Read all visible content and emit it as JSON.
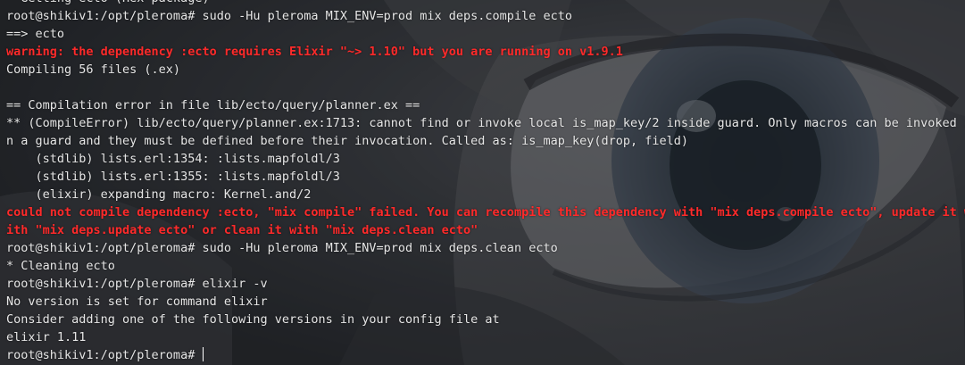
{
  "terminal": {
    "lines": [
      {
        "text": "  Getting ecto (Hex package)",
        "style": "normal"
      },
      {
        "text": "root@shikiv1:/opt/pleroma# sudo -Hu pleroma MIX_ENV=prod mix deps.compile ecto",
        "style": "normal"
      },
      {
        "text": "==> ecto",
        "style": "normal"
      },
      {
        "text": "warning: the dependency :ecto requires Elixir \"~> 1.10\" but you are running on v1.9.1",
        "style": "error"
      },
      {
        "text": "Compiling 56 files (.ex)",
        "style": "normal"
      },
      {
        "text": "",
        "style": "normal"
      },
      {
        "text": "== Compilation error in file lib/ecto/query/planner.ex ==",
        "style": "normal"
      },
      {
        "text": "** (CompileError) lib/ecto/query/planner.ex:1713: cannot find or invoke local is_map_key/2 inside guard. Only macros can be invoked i",
        "style": "normal"
      },
      {
        "text": "n a guard and they must be defined before their invocation. Called as: is_map_key(drop, field)",
        "style": "normal"
      },
      {
        "text": "    (stdlib) lists.erl:1354: :lists.mapfoldl/3",
        "style": "normal"
      },
      {
        "text": "    (stdlib) lists.erl:1355: :lists.mapfoldl/3",
        "style": "normal"
      },
      {
        "text": "    (elixir) expanding macro: Kernel.and/2",
        "style": "normal"
      },
      {
        "text": "could not compile dependency :ecto, \"mix compile\" failed. You can recompile this dependency with \"mix deps.compile ecto\", update it w",
        "style": "error"
      },
      {
        "text": "ith \"mix deps.update ecto\" or clean it with \"mix deps.clean ecto\"",
        "style": "error"
      },
      {
        "text": "root@shikiv1:/opt/pleroma# sudo -Hu pleroma MIX_ENV=prod mix deps.clean ecto",
        "style": "normal"
      },
      {
        "text": "* Cleaning ecto",
        "style": "normal"
      },
      {
        "text": "root@shikiv1:/opt/pleroma# elixir -v",
        "style": "normal"
      },
      {
        "text": "No version is set for command elixir",
        "style": "normal"
      },
      {
        "text": "Consider adding one of the following versions in your config file at",
        "style": "normal"
      },
      {
        "text": "elixir 1.11",
        "style": "normal"
      }
    ],
    "prompt": "root@shikiv1:/opt/pleroma# ",
    "colors": {
      "text": "#e6e6e6",
      "error": "#ff2a2a",
      "background": "#2b2d30",
      "cursor": "#ffffff"
    }
  }
}
